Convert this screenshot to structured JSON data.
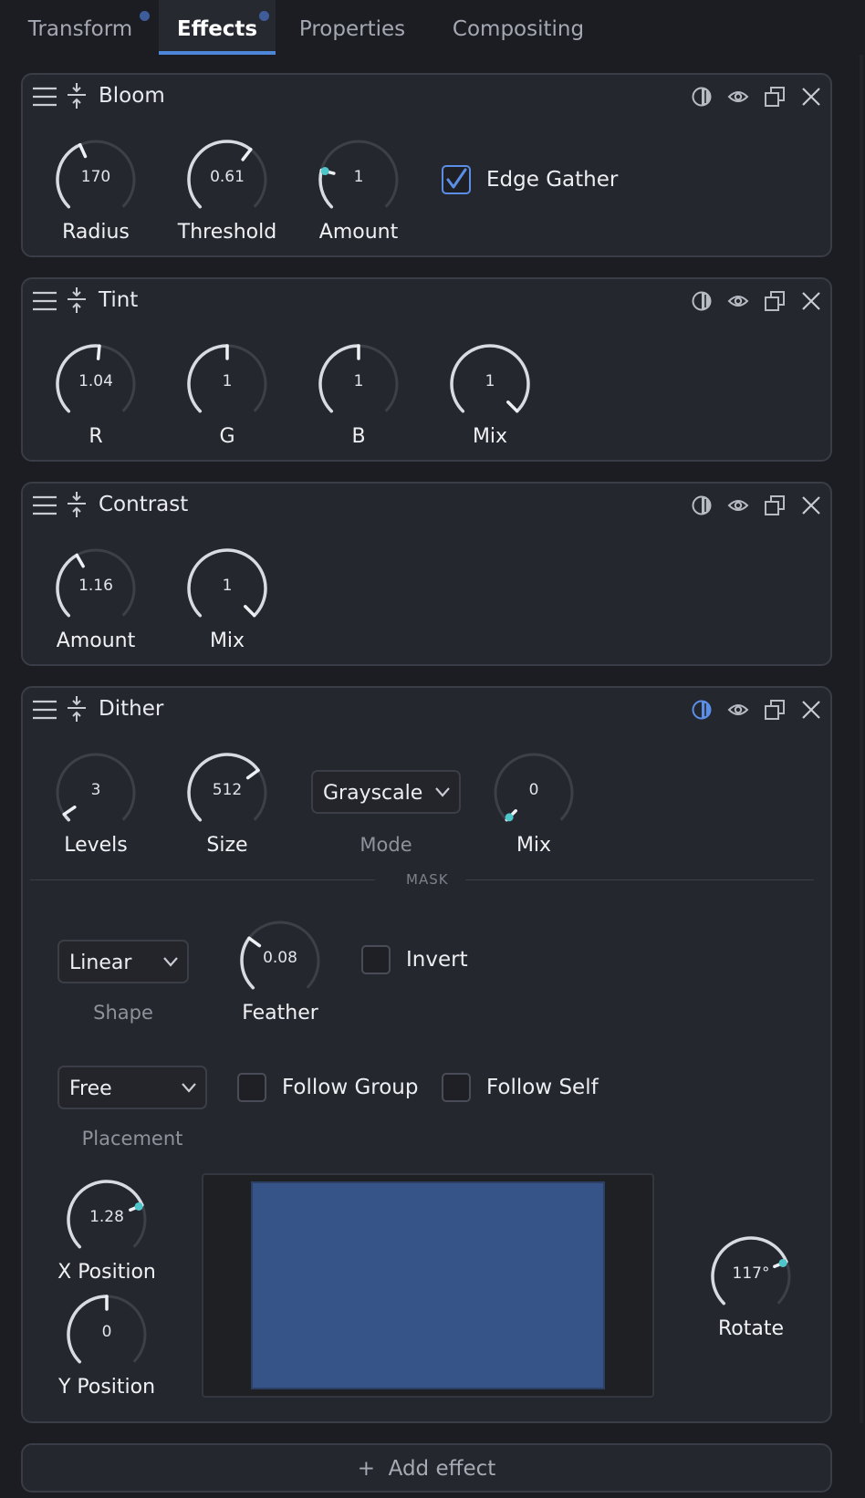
{
  "tabs": [
    {
      "label": "Transform",
      "dot": true
    },
    {
      "label": "Effects",
      "dot": true,
      "active": true
    },
    {
      "label": "Properties",
      "dot": false
    },
    {
      "label": "Compositing",
      "dot": false
    }
  ],
  "colors": {
    "accent": "#4d86d9",
    "knob_dot": "#4fc6c9",
    "panel": "#25272e",
    "preview_fill": "#365487"
  },
  "bloom": {
    "title": "Bloom",
    "knobs": [
      {
        "label": "Radius",
        "value": "170",
        "fraction": 0.41
      },
      {
        "label": "Threshold",
        "value": "0.61",
        "fraction": 0.64
      },
      {
        "label": "Amount",
        "value": "1",
        "fraction": 0.22
      }
    ],
    "edge_gather": {
      "label": "Edge Gather",
      "checked": true
    }
  },
  "tint": {
    "title": "Tint",
    "knobs": [
      {
        "label": "R",
        "value": "1.04",
        "fraction": 0.52
      },
      {
        "label": "G",
        "value": "1",
        "fraction": 0.5
      },
      {
        "label": "B",
        "value": "1",
        "fraction": 0.5
      },
      {
        "label": "Mix",
        "value": "1",
        "fraction": 1.0
      }
    ]
  },
  "contrast": {
    "title": "Contrast",
    "knobs": [
      {
        "label": "Amount",
        "value": "1.16",
        "fraction": 0.39
      },
      {
        "label": "Mix",
        "value": "1",
        "fraction": 1.0
      }
    ]
  },
  "dither": {
    "title": "Dither",
    "knobs": [
      {
        "label": "Levels",
        "value": "3",
        "fraction": 0.04
      },
      {
        "label": "Size",
        "value": "512",
        "fraction": 0.7
      },
      {
        "label": "Mix",
        "value": "0",
        "fraction": 0.0
      }
    ],
    "mode": {
      "value": "Grayscale",
      "label": "Mode"
    },
    "mask_title": "MASK",
    "shape": {
      "value": "Linear",
      "label": "Shape"
    },
    "feather": {
      "label": "Feather",
      "value": "0.08",
      "fraction": 0.3
    },
    "invert": {
      "label": "Invert",
      "checked": false
    },
    "placement": {
      "value": "Free",
      "label": "Placement"
    },
    "follow_group": {
      "label": "Follow Group",
      "checked": false
    },
    "follow_self": {
      "label": "Follow Self",
      "checked": false
    },
    "x_position": {
      "label": "X Position",
      "value": "1.28",
      "fraction": 0.75
    },
    "y_position": {
      "label": "Y Position",
      "value": "0",
      "fraction": 0.5
    },
    "rotate": {
      "label": "Rotate",
      "value": "117°",
      "fraction": 0.75
    }
  },
  "add_effect": {
    "label": "Add effect",
    "icon": "plus-icon"
  }
}
